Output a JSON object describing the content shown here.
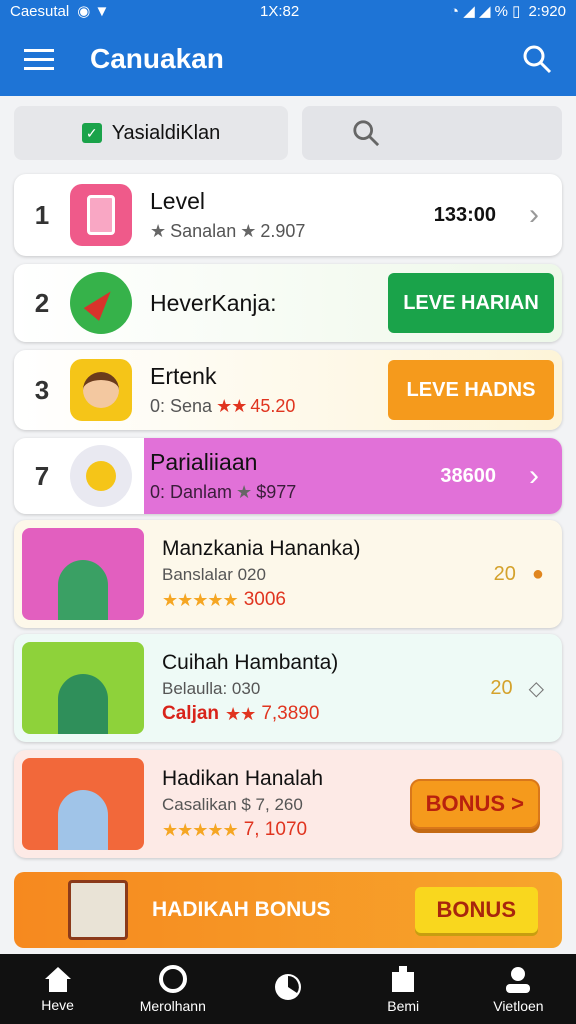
{
  "statusbar": {
    "carrier": "Caesutal",
    "time": "1X:82",
    "right": "2:920"
  },
  "appbar": {
    "title": "Canuakan"
  },
  "filters": {
    "chip_label": "YasialdiKlan"
  },
  "rows": [
    {
      "rank": "1",
      "name": "Level",
      "sub": "Sanalan",
      "rating": "2.907",
      "value": "133:00"
    },
    {
      "rank": "2",
      "name": "HeverKanja:",
      "button": "LEVE HARIAN"
    },
    {
      "rank": "3",
      "name": "Ertenk",
      "sub": "0: Sena",
      "rating": "45.20",
      "button": "LEVE HADNS"
    },
    {
      "rank": "7",
      "name": "Parialiiaan",
      "sub": "0: Danlam",
      "rating": "$977",
      "value": "38600"
    }
  ],
  "cards": [
    {
      "name": "Manzkania Hananka)",
      "sub": "Banslalar 020",
      "rating": "3006",
      "trail": "20"
    },
    {
      "name": "Cuihah Hambanta)",
      "sub": "Belaulla: 030",
      "rating": "7,3890",
      "prefix": "Caljan",
      "trail": "20"
    },
    {
      "name": "Hadikan Hanalah",
      "sub": "Casalikan $ 7, 260",
      "rating": "7, 1070",
      "button": "BONUS >"
    }
  ],
  "banner": {
    "text": "HADIKAH BONUS",
    "button": "BONUS"
  },
  "nav": [
    "Heve",
    "Merolhann",
    "",
    "Bemi",
    "Vietloen"
  ],
  "colors": {
    "primary": "#1e74d6",
    "green": "#1aa34a",
    "orange": "#f59a1c",
    "purple": "#e171d8"
  }
}
